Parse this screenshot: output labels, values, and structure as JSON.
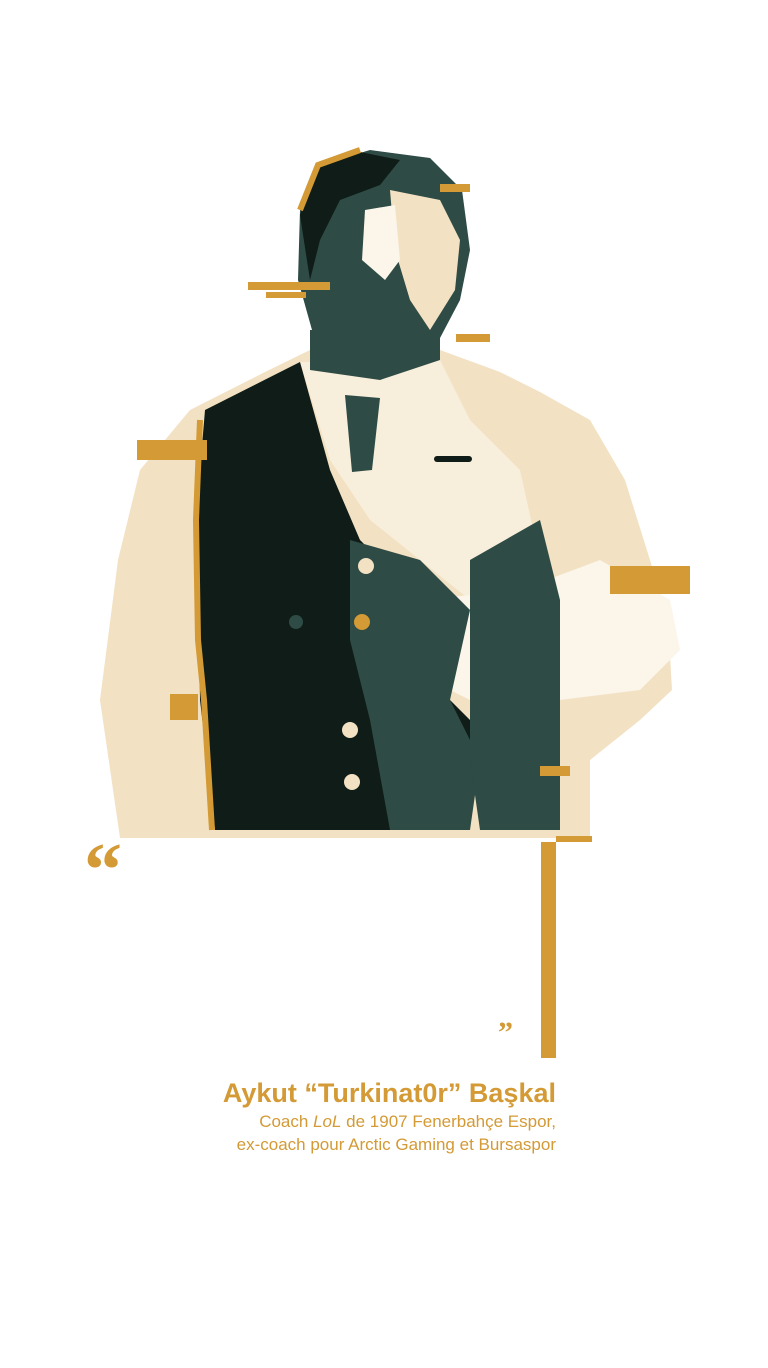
{
  "colors": {
    "accent": "#D39A35",
    "dark": "#0F1C17",
    "mid": "#2E4B45",
    "light": "#F3E1C3",
    "background": "#FFFFFF"
  },
  "illustration": {
    "subject": "posterized portrait of a coach in a dark vest and white shirt"
  },
  "quote": {
    "open_mark": "“",
    "close_mark": "”",
    "text": ""
  },
  "attribution": {
    "name": "Aykut “Turkinat0r” Başkal",
    "role_line1_prefix": "Coach ",
    "role_line1_game": "LoL",
    "role_line1_suffix": " de 1907 Fenerbahçe Espor,",
    "role_line2": "ex-coach pour Arctic Gaming et Bursaspor"
  }
}
